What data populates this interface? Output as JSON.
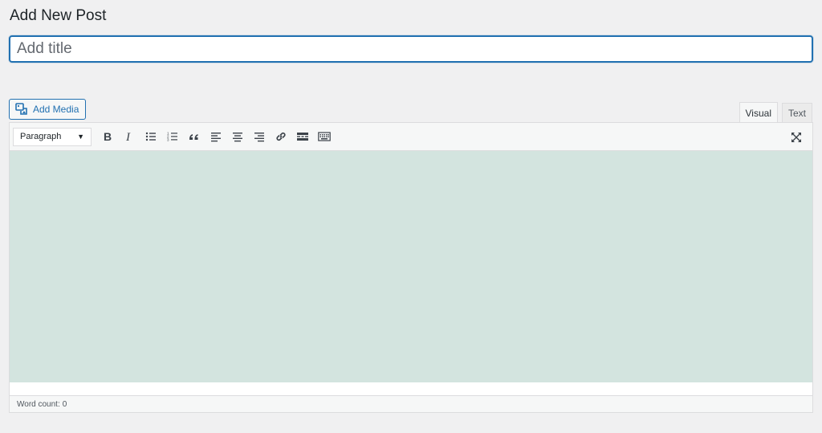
{
  "page": {
    "title": "Add New Post"
  },
  "title_input": {
    "placeholder": "Add title",
    "value": ""
  },
  "media": {
    "add_media_label": "Add Media",
    "icon": "add-media-icon"
  },
  "tabs": [
    {
      "label": "Visual",
      "active": true
    },
    {
      "label": "Text",
      "active": false
    }
  ],
  "toolbar": {
    "format_value": "Paragraph",
    "buttons": [
      {
        "name": "bold",
        "icon": "bold-icon"
      },
      {
        "name": "italic",
        "icon": "italic-icon"
      },
      {
        "name": "bulleted-list",
        "icon": "bulleted-list-icon"
      },
      {
        "name": "numbered-list",
        "icon": "numbered-list-icon"
      },
      {
        "name": "blockquote",
        "icon": "blockquote-icon"
      },
      {
        "name": "align-left",
        "icon": "align-left-icon"
      },
      {
        "name": "align-center",
        "icon": "align-center-icon"
      },
      {
        "name": "align-right",
        "icon": "align-right-icon"
      },
      {
        "name": "insert-link",
        "icon": "link-icon"
      },
      {
        "name": "read-more",
        "icon": "read-more-icon"
      },
      {
        "name": "toolbar-toggle",
        "icon": "keyboard-icon"
      }
    ],
    "fullscreen_icon": "fullscreen-icon"
  },
  "status": {
    "word_count_label": "Word count:",
    "word_count_value": "0"
  },
  "colors": {
    "accent": "#2271b1",
    "background": "#f0f0f1",
    "content_area": "#d3e4df"
  }
}
